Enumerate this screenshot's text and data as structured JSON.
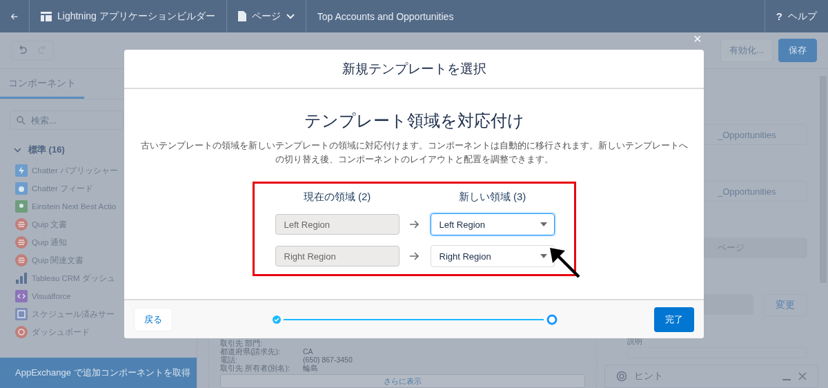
{
  "header": {
    "app_title": "Lightning アプリケーションビルダー",
    "page_menu": "ページ",
    "page_name": "Top Accounts and Opportunities",
    "help_icon": "?",
    "help": "ヘルプ"
  },
  "toolbar": {
    "buttons": [
      {
        "label": "有効化...",
        "kind": "neutral"
      },
      {
        "label": "保存",
        "kind": "brand"
      }
    ]
  },
  "left_panel": {
    "tabs": [
      {
        "label": "コンポーネント",
        "selected": true
      }
    ],
    "search": {
      "placeholder": "検索..."
    },
    "section": {
      "label": "標準 (16)",
      "expanded": true
    },
    "items": [
      {
        "label": "Chatter パブリッシャー",
        "kind": "bolt",
        "color": "#6c9dcc"
      },
      {
        "label": "Chatter フィード",
        "kind": "chat",
        "color": "#6c9dcc"
      },
      {
        "label": "Einstein Next Best Actio",
        "kind": "einstein",
        "color": "#6e9e7c"
      },
      {
        "label": "Quip 文書",
        "kind": "quip",
        "color": "#c07f7a"
      },
      {
        "label": "Quip 通知",
        "kind": "quip",
        "color": "#c07f7a"
      },
      {
        "label": "Quip 関連文書",
        "kind": "quip",
        "color": "#c07f7a"
      },
      {
        "label": "Tableau CRM ダッシュ",
        "kind": "chart",
        "color": "#5a7394"
      },
      {
        "label": "Visualforce",
        "kind": "code",
        "color": "#8c74b8"
      },
      {
        "label": "スケジュール済みサー",
        "kind": "calendar",
        "color": "#7d8eb8"
      },
      {
        "label": "ダッシュボード",
        "kind": "dashboard",
        "color": "#c07f7a"
      }
    ],
    "footer": "AppExchange で追加コンポーネントを取得"
  },
  "canvas": {
    "fields": [
      {
        "label": "取引先 部門:"
      },
      {
        "label": "都道府県(請求先):",
        "value": "CA"
      },
      {
        "label": "電話:",
        "value": "(650) 867-3450"
      },
      {
        "label": "取引先 所有者(別名):",
        "value": "輪島"
      }
    ],
    "more_button": "さらに表示"
  },
  "right_panel": {
    "fields": [
      {
        "value": "_Opportunities",
        "disabled": false
      },
      {
        "value": "_Opportunities",
        "disabled": false
      },
      {
        "value": "ページ",
        "disabled": true
      }
    ],
    "change_button": "変更",
    "description_label": "説明"
  },
  "modal": {
    "close": "×",
    "title": "新規テンプレートを選択",
    "heading": "テンプレート領域を対応付け",
    "description": "古いテンプレートの領域を新しいテンプレートの領域に対応付けます。コンポーネントは自動的に移行されます。新しいテンプレートへの切り替え後、コンポーネントのレイアウトと配置を調整できます。",
    "columns": [
      "現在の領域 (2)",
      "新しい領域 (3)"
    ],
    "mappings": [
      {
        "current": "Left Region",
        "new": "Left Region",
        "focused": true
      },
      {
        "current": "Right Region",
        "new": "Right Region",
        "focused": false
      }
    ],
    "back_button": "戻る",
    "finish_button": "完了",
    "steps": [
      {
        "complete": true,
        "selected": false
      },
      {
        "complete": false,
        "selected": true
      }
    ]
  },
  "hint_panel": {
    "title": "ヒント"
  }
}
